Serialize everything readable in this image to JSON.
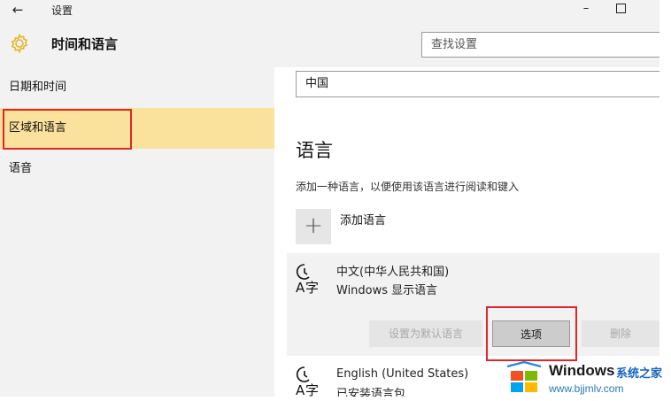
{
  "titlebar": {
    "title": "设置",
    "back_glyph": "←",
    "minimize_glyph": "–"
  },
  "header": {
    "title": "时间和语言",
    "search_placeholder": "查找设置"
  },
  "sidebar": {
    "items": [
      {
        "label": "日期和时间",
        "active": false
      },
      {
        "label": "区域和语言",
        "active": true
      },
      {
        "label": "语音",
        "active": false
      }
    ]
  },
  "main": {
    "region_value": "中国",
    "language_title": "语言",
    "language_desc": "添加一种语言，以便使用该语言进行阅读和键入",
    "add_language_label": "添加语言",
    "add_glyph": "+",
    "languages": [
      {
        "name": "中文(中华人民共和国)",
        "status": "Windows 显示语言"
      },
      {
        "name": "English (United States)",
        "status": "已安装语言包"
      }
    ],
    "buttons": {
      "set_default": "设置为默认语言",
      "options": "选项",
      "remove": "删除"
    }
  },
  "watermark": {
    "brand": "Windows",
    "brand_cn": "系统之家",
    "url": "www.bjjmlv.com"
  },
  "colors": {
    "active_nav": "#fbe29c",
    "highlight_red": "#e0262a",
    "gear_yellow": "#e8b52a"
  },
  "icons": [
    "back-arrow-icon",
    "gear-icon",
    "minimize-icon",
    "maximize-icon",
    "plus-icon",
    "language-icon",
    "windows-logo-icon"
  ]
}
